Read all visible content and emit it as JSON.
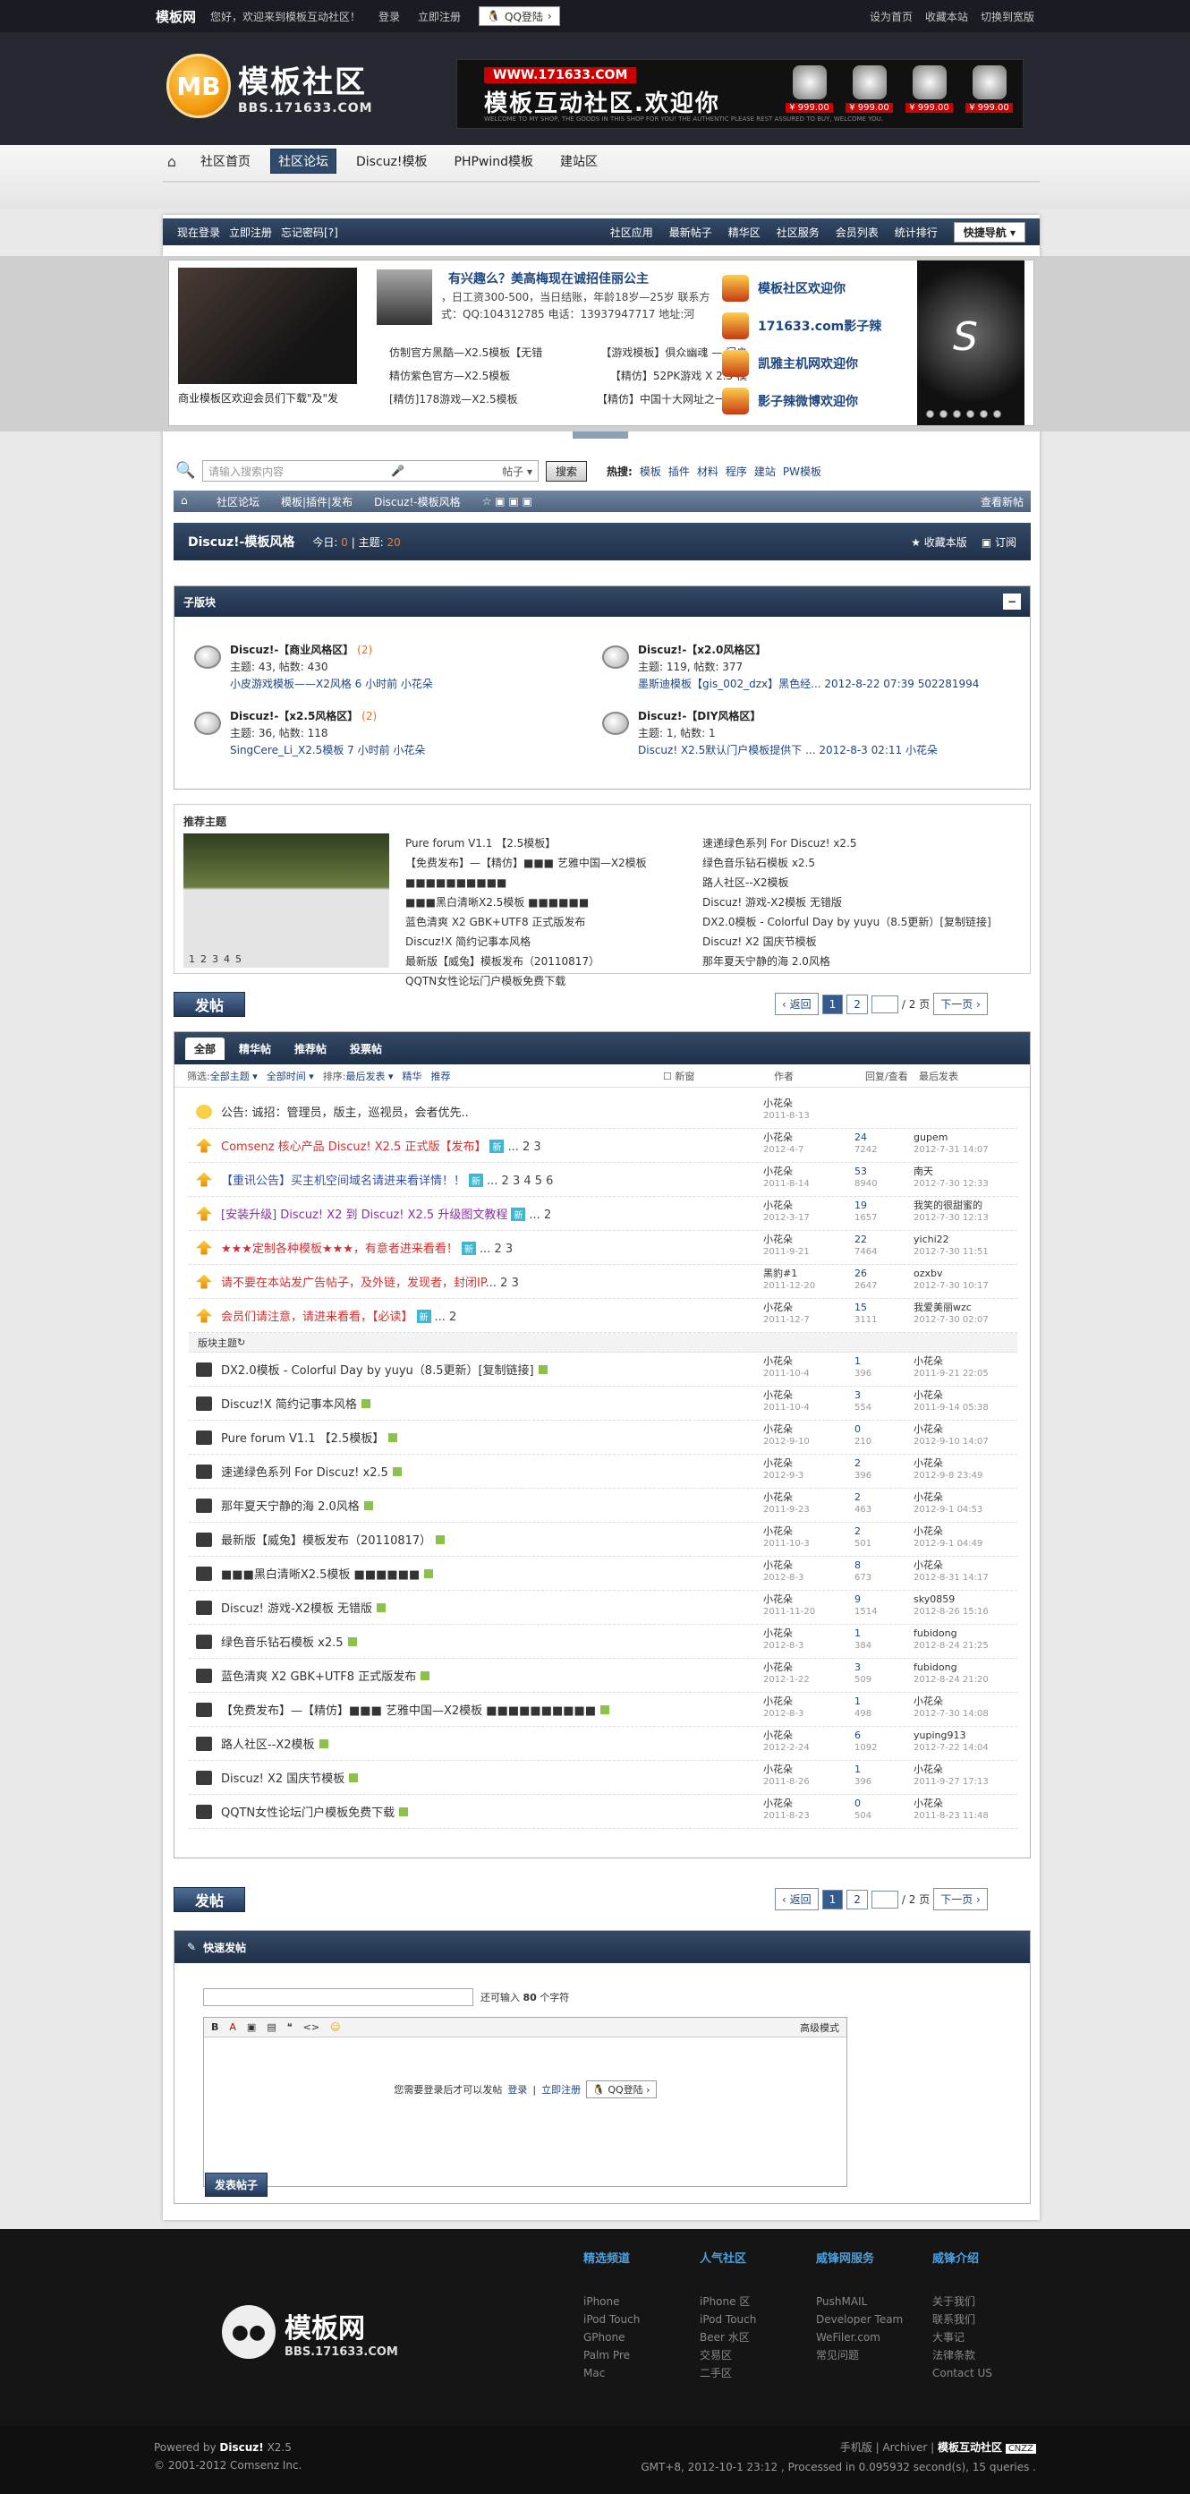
{
  "topbar": {
    "brand": "模板网",
    "welcome": "您好，欢迎来到模板互动社区！",
    "login": "登录",
    "register": "立即注册",
    "qq": "QQ登陆",
    "right": [
      "设为首页",
      "收藏本站",
      "切换到宽版"
    ]
  },
  "header": {
    "logo_mb": "MB",
    "logo_title": "模板社区",
    "logo_url": "BBS.171633.COM",
    "banner_url": "WWW.171633.COM",
    "banner_title": "模板互动社区.欢迎你",
    "banner_small": "WELCOME TO MY SHOP, THE GOODS IN THIS SHOP FOR YOU! THE AUTHENTIC PLEASE REST ASSURED TO BUY, WELCOME YOU.",
    "products": [
      "¥ 999.00",
      "¥ 999.00",
      "¥ 999.00",
      "¥ 999.00"
    ]
  },
  "nav": {
    "items": [
      "社区首页",
      "社区论坛",
      "Discuz!模板",
      "PHPwind模板",
      "建站区"
    ],
    "active": 1
  },
  "subbar": {
    "left": [
      "现在登录",
      "立即注册",
      "忘记密码[?]"
    ],
    "right": [
      "社区应用",
      "最新帖子",
      "精华区",
      "社区服务",
      "会员列表",
      "统计排行"
    ],
    "quick": "快捷导航"
  },
  "slide": {
    "photo_caption": "商业模板区欢迎会员们下载\"及\"发",
    "headline": "有兴趣么？美高梅现在诚招佳丽公主",
    "desc": "，日工资300-500，当日结账，年龄18岁—25岁 联系方式：QQ:104312785 电话：13937947717 地址:河",
    "hl": [
      [
        "仿制官方黑酷—X2.5模板【无错",
        "【游戏模板】俱众幽魂 — 门户"
      ],
      [
        "精仿紫色官方—X2.5模板",
        "【精仿】52PK游戏 X 2.5 模"
      ],
      [
        "[精仿]178游戏—X2.5模板",
        "【精仿】中国十大网址之一【炸"
      ]
    ],
    "side": [
      "模板社区欢迎你",
      "171633.com影子辣",
      "凯雅主机网欢迎你",
      "影子辣微博欢迎你"
    ]
  },
  "search": {
    "placeholder": "请输入搜索内容",
    "scope": "帖子",
    "button": "搜索",
    "hot_label": "热搜:",
    "hot": [
      "模板",
      "插件",
      "材料",
      "程序",
      "建站",
      "PW模板"
    ]
  },
  "crumb": {
    "items": [
      "社区论坛",
      "模板|插件|发布",
      "Discuz!-模板风格"
    ],
    "new": "查看新帖"
  },
  "forum": {
    "title": "Discuz!-模板风格",
    "today_label": "今日:",
    "today": "0",
    "topics_label": "主题:",
    "topics": "20",
    "fav": "收藏本版",
    "sub": "订阅"
  },
  "subforums": {
    "title": "子版块",
    "items": [
      {
        "name": "Discuz!-【商业风格区】",
        "count": "(2)",
        "stats": "主题: 43, 帖数: 430",
        "last": "小皮游戏模板——X2风格 6 小时前 小花朵"
      },
      {
        "name": "Discuz!-【x2.0风格区】",
        "count": "",
        "stats": "主题: 119, 帖数: 377",
        "last": "墨斯迪模板【gis_002_dzx】黑色经... 2012-8-22 07:39 502281994"
      },
      {
        "name": "Discuz!-【x2.5风格区】",
        "count": "(2)",
        "stats": "主题: 36, 帖数: 118",
        "last": "SingCere_Li_X2.5模板 7 小时前 小花朵"
      },
      {
        "name": "Discuz!-【DIY风格区】",
        "count": "",
        "stats": "主题: 1, 帖数: 1",
        "last": "Discuz! X2.5默认门户模板提供下 ... 2012-8-3 02:11 小花朵"
      }
    ]
  },
  "recommend": {
    "title": "推荐主题",
    "pages": [
      "1",
      "2",
      "3",
      "4",
      "5"
    ],
    "col1": [
      "Pure forum V1.1 【2.5模板】",
      "【免费发布】—【精仿】■■■ 艺雅中国—X2模板 ■■■■■■■■■■",
      "■■■黑白清晰X2.5模板 ■■■■■■",
      "蓝色清爽 X2 GBK+UTF8 正式版发布",
      "Discuz!X 简约记事本风格",
      "最新版【威兔】模板发布（20110817）",
      "QQTN女性论坛门户模板免费下载"
    ],
    "col2": [
      "速递绿色系列 For Discuz! x2.5",
      "绿色音乐钻石模板 x2.5",
      "路人社区--X2模板",
      "Discuz! 游戏-X2模板 无错版",
      "DX2.0模板 - Colorful Day by yuyu（8.5更新）[复制链接]",
      "Discuz! X2 国庆节模板",
      "那年夏天宁静的海 2.0风格"
    ]
  },
  "pager": {
    "post": "发帖",
    "prev": "‹ 返回",
    "pages": [
      "1",
      "2"
    ],
    "total": "/ 2 页",
    "next": "下一页 ›"
  },
  "threads": {
    "tabs": [
      "全部",
      "精华帖",
      "推荐帖",
      "投票帖"
    ],
    "filter_label": "筛选:",
    "filters": [
      "全部主题 ▾",
      "全部时间 ▾"
    ],
    "sort_label": "排序:",
    "sort": "最后发表 ▾",
    "extra": [
      "精华",
      "推荐"
    ],
    "newwin": "新窗",
    "col_author": "作者",
    "col_reply": "回复/查看",
    "col_last": "最后发表",
    "section": "版块主题",
    "announce": {
      "title": "公告: 诚招：管理员，版主，巡视员，会者优先..",
      "author": "小花朵",
      "date": "2011-8-13"
    },
    "sticky": [
      {
        "title": "Comsenz 核心产品 Discuz! X2.5 正式版【发布】",
        "tag": "新",
        "pages": "... 2 3",
        "author": "小花朵",
        "date": "2012-4-7",
        "r": "24",
        "v": "7242",
        "lu": "gupem",
        "ld": "2012-7-31 14:07",
        "color": "#d23030"
      },
      {
        "title": "【重讯公告】买主机空间域名请进来看详情！！",
        "tag": "新",
        "pages": "... 2 3 4 5 6",
        "author": "小花朵",
        "date": "2011-8-14",
        "r": "53",
        "v": "8940",
        "lu": "南天",
        "ld": "2012-7-30 12:33",
        "color": "#3451a8"
      },
      {
        "title": "[安装升级] Discuz! X2 到 Discuz! X2.5 升级图文教程",
        "tag": "新",
        "pages": "... 2",
        "author": "小花朵",
        "date": "2012-3-17",
        "r": "19",
        "v": "1657",
        "lu": "我笑的很甜蜜的",
        "ld": "2012-7-30 12:13",
        "color": "#8a2ea6"
      },
      {
        "title": "★★★定制各种模板★★★，有意者进来看看！",
        "tag": "新",
        "pages": "... 2 3",
        "author": "小花朵",
        "date": "2011-9-21",
        "r": "22",
        "v": "7464",
        "lu": "yichi22",
        "ld": "2012-7-30 11:51",
        "color": "#d23030"
      },
      {
        "title": "请不要在本站发广告帖子，及外链，发现者，封闭IP",
        "tag": "",
        "pages": "... 2 3",
        "author": "黑豹#1",
        "date": "2011-12-20",
        "r": "26",
        "v": "2647",
        "lu": "ozxbv",
        "ld": "2012-7-30 10:17",
        "color": "#d23030"
      },
      {
        "title": "会员们请注意，请进来看看，【必读】",
        "tag": "新",
        "pages": "... 2",
        "author": "小花朵",
        "date": "2011-12-7",
        "r": "15",
        "v": "3111",
        "lu": "我爱美丽wzc",
        "ld": "2012-7-30 02:07",
        "color": "#d23030"
      }
    ],
    "normal": [
      {
        "title": "DX2.0模板 - Colorful Day by yuyu（8.5更新）[复制链接]",
        "author": "小花朵",
        "date": "2011-10-4",
        "r": "1",
        "v": "396",
        "lu": "小花朵",
        "ld": "2011-9-21 22:05"
      },
      {
        "title": "Discuz!X 简约记事本风格",
        "author": "小花朵",
        "date": "2011-10-4",
        "r": "3",
        "v": "554",
        "lu": "小花朵",
        "ld": "2011-9-14 05:38"
      },
      {
        "title": "Pure forum V1.1 【2.5模板】",
        "author": "小花朵",
        "date": "2012-9-10",
        "r": "0",
        "v": "210",
        "lu": "小花朵",
        "ld": "2012-9-10 14:07"
      },
      {
        "title": "速递绿色系列 For Discuz! x2.5",
        "author": "小花朵",
        "date": "2012-9-3",
        "r": "2",
        "v": "396",
        "lu": "小花朵",
        "ld": "2012-9-8 23:49"
      },
      {
        "title": "那年夏天宁静的海 2.0风格",
        "author": "小花朵",
        "date": "2011-9-23",
        "r": "2",
        "v": "463",
        "lu": "小花朵",
        "ld": "2012-9-1 04:53"
      },
      {
        "title": "最新版【威兔】模板发布（20110817）",
        "author": "小花朵",
        "date": "2011-10-3",
        "r": "2",
        "v": "501",
        "lu": "小花朵",
        "ld": "2012-9-1 04:49"
      },
      {
        "title": "■■■黑白清晰X2.5模板 ■■■■■■",
        "author": "小花朵",
        "date": "2012-8-3",
        "r": "8",
        "v": "673",
        "lu": "小花朵",
        "ld": "2012-8-31 14:17"
      },
      {
        "title": "Discuz! 游戏-X2模板 无错版",
        "author": "小花朵",
        "date": "2011-11-20",
        "r": "9",
        "v": "1514",
        "lu": "sky0859",
        "ld": "2012-8-26 15:16"
      },
      {
        "title": "绿色音乐钻石模板 x2.5",
        "author": "小花朵",
        "date": "2012-8-3",
        "r": "1",
        "v": "384",
        "lu": "fubidong",
        "ld": "2012-8-24 21:25"
      },
      {
        "title": "蓝色清爽 X2 GBK+UTF8 正式版发布",
        "author": "小花朵",
        "date": "2012-1-22",
        "r": "3",
        "v": "509",
        "lu": "fubidong",
        "ld": "2012-8-24 21:20"
      },
      {
        "title": "【免费发布】—【精仿】■■■ 艺雅中国—X2模板 ■■■■■■■■■■",
        "author": "小花朵",
        "date": "2012-8-3",
        "r": "1",
        "v": "498",
        "lu": "小花朵",
        "ld": "2012-7-30 14:08"
      },
      {
        "title": "路人社区--X2模板",
        "author": "小花朵",
        "date": "2012-2-24",
        "r": "6",
        "v": "1092",
        "lu": "yuping913",
        "ld": "2012-7-22 14:04"
      },
      {
        "title": "Discuz! X2 国庆节模板",
        "author": "小花朵",
        "date": "2011-8-26",
        "r": "1",
        "v": "396",
        "lu": "小花朵",
        "ld": "2011-9-27 17:13"
      },
      {
        "title": "QQTN女性论坛门户模板免费下载",
        "author": "小花朵",
        "date": "2011-8-23",
        "r": "0",
        "v": "504",
        "lu": "小花朵",
        "ld": "2011-8-23 11:48"
      }
    ]
  },
  "quickpost": {
    "title": "快速发帖",
    "limit_pre": "还可输入",
    "limit": "80",
    "limit_post": "个字符",
    "tools": [
      "B",
      "A",
      "▣",
      "▤",
      "❝",
      "<>",
      "☺"
    ],
    "advanced": "高级模式",
    "need_login": "您需要登录后才可以发帖",
    "login": "登录",
    "register": "立即注册",
    "qq": "QQ登陆",
    "send": "发表帖子"
  },
  "footer": {
    "logo_title": "模板网",
    "logo_url": "BBS.171633.COM",
    "cols": [
      {
        "h": "精选频道",
        "items": [
          "iPhone",
          "iPod Touch",
          "GPhone",
          "Palm Pre",
          "Mac"
        ]
      },
      {
        "h": "人气社区",
        "items": [
          "iPhone 区",
          "iPod Touch",
          "Beer 水区",
          "交易区",
          "二手区"
        ]
      },
      {
        "h": "威锋网服务",
        "items": [
          "PushMAIL",
          "Developer Team",
          "WeFiler.com",
          "常见问题"
        ]
      },
      {
        "h": "威锋介绍",
        "items": [
          "关于我们",
          "联系我们",
          "大事记",
          "法律条款",
          "Contact US"
        ]
      }
    ],
    "powered": "Powered by",
    "powered_b": "Discuz!",
    "powered_v": "X2.5",
    "copy": "© 2001-2012 Comsenz Inc.",
    "links": "手机版 | Archiver |",
    "site": "模板互动社区",
    "gmt": "GMT+8, 2012-10-1 23:12 , Processed in 0.095932 second(s), 15 queries ."
  },
  "colors": {
    "accent": "#1f3049",
    "link": "#1d4680",
    "highlight": "#ff6a00"
  }
}
